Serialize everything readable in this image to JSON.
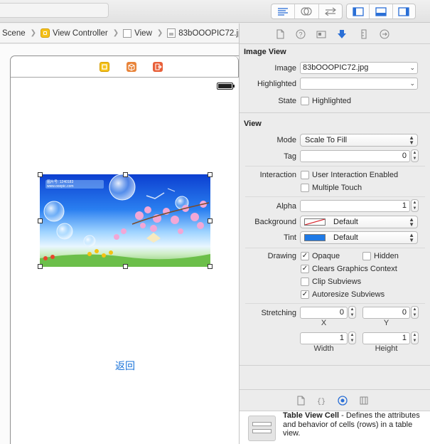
{
  "jumpbar": {
    "items": [
      "Scene",
      "View Controller",
      "View",
      "83bOOOPIC72.jpg"
    ]
  },
  "toolbar": {
    "editor_icons": [
      "standard-editor-icon",
      "assistant-editor-icon",
      "version-editor-icon"
    ],
    "view_icons": [
      "navigator-toggle-icon",
      "debug-area-toggle-icon",
      "utilities-toggle-icon"
    ]
  },
  "canvas": {
    "back_button_label": "返回",
    "image_caption_line1": "图片号: 1240183",
    "image_caption_line2": "www.ooopic.com"
  },
  "inspector": {
    "image_view": {
      "title": "Image View",
      "image_label": "Image",
      "image_value": "83bOOOPIC72.jpg",
      "highlighted_label": "Highlighted",
      "highlighted_value": "",
      "state_label": "State",
      "state_option": "Highlighted",
      "state_checked": false
    },
    "view": {
      "title": "View",
      "mode_label": "Mode",
      "mode_value": "Scale To Fill",
      "tag_label": "Tag",
      "tag_value": "0",
      "interaction_label": "Interaction",
      "user_interaction": "User Interaction Enabled",
      "multiple_touch": "Multiple Touch",
      "alpha_label": "Alpha",
      "alpha_value": "1",
      "background_label": "Background",
      "background_value": "Default",
      "tint_label": "Tint",
      "tint_value": "Default",
      "tint_color": "#1f7ae6",
      "drawing_label": "Drawing",
      "opaque": "Opaque",
      "hidden": "Hidden",
      "clears_graphics": "Clears Graphics Context",
      "clip_subviews": "Clip Subviews",
      "autoresize_subviews": "Autoresize Subviews",
      "stretching_label": "Stretching",
      "stretch_x": "0",
      "stretch_y": "0",
      "stretch_width": "1",
      "stretch_height": "1",
      "x_label": "X",
      "y_label": "Y",
      "width_label": "Width",
      "height_label": "Height"
    }
  },
  "library": {
    "item_title": "Table View Cell",
    "item_desc": " - Defines the attributes and behavior of cells (rows) in a table view."
  }
}
